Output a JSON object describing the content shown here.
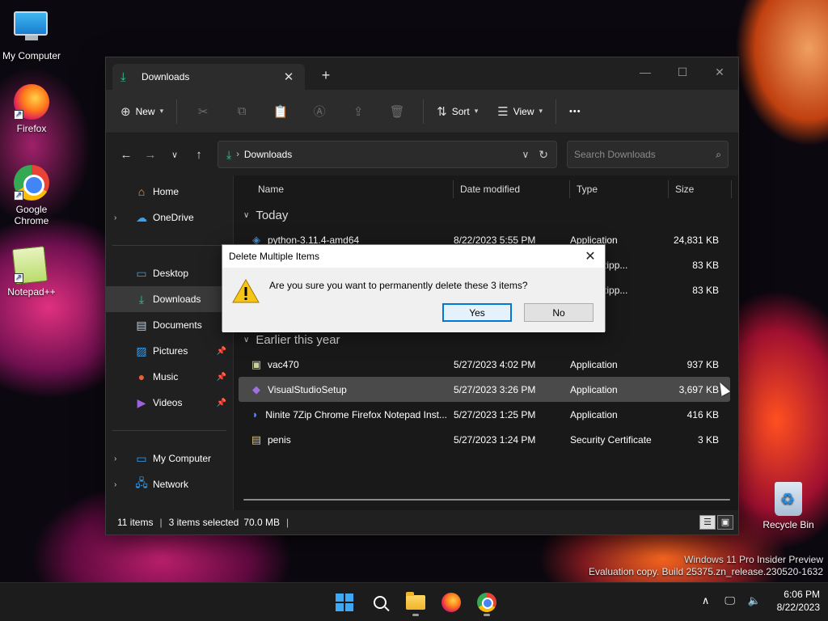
{
  "desktop": {
    "icons": [
      {
        "label": "My Computer"
      },
      {
        "label": "Firefox"
      },
      {
        "label": "Google Chrome"
      },
      {
        "label": "Notepad++"
      }
    ],
    "recycle_bin": "Recycle Bin",
    "watermark_line1": "Windows 11 Pro Insider Preview",
    "watermark_line2": "Evaluation copy. Build 25375.zn_release.230520-1632"
  },
  "window": {
    "tab_title": "Downloads",
    "new_tab_symbol": "+",
    "toolbar": {
      "new_label": "New",
      "sort_label": "Sort",
      "view_label": "View",
      "more_symbol": "•••"
    },
    "address": {
      "crumb": "Downloads",
      "search_placeholder": "Search Downloads"
    },
    "sidebar": {
      "items": [
        {
          "label": "Home",
          "icon": "home-icon",
          "expandable": false,
          "pinned": false
        },
        {
          "label": "OneDrive",
          "icon": "cloud-icon",
          "expandable": true,
          "pinned": false
        },
        {
          "label": "Desktop",
          "icon": "desktop-icon",
          "expandable": false,
          "pinned": false
        },
        {
          "label": "Downloads",
          "icon": "download-icon",
          "expandable": false,
          "pinned": false,
          "active": true
        },
        {
          "label": "Documents",
          "icon": "document-icon",
          "expandable": false,
          "pinned": false
        },
        {
          "label": "Pictures",
          "icon": "pictures-icon",
          "expandable": false,
          "pinned": true
        },
        {
          "label": "Music",
          "icon": "music-icon",
          "expandable": false,
          "pinned": true
        },
        {
          "label": "Videos",
          "icon": "videos-icon",
          "expandable": false,
          "pinned": true
        },
        {
          "label": "My Computer",
          "icon": "computer-icon",
          "expandable": true,
          "pinned": false
        },
        {
          "label": "Network",
          "icon": "network-icon",
          "expandable": true,
          "pinned": false
        }
      ]
    },
    "columns": {
      "name": "Name",
      "date": "Date modified",
      "type": "Type",
      "size": "Size"
    },
    "groups": [
      {
        "label": "Today",
        "rows": [
          {
            "name": "python-3.11.4-amd64",
            "date": "8/22/2023 5:55 PM",
            "type": "Application",
            "size": "24,831 KB",
            "icon": "python-installer-icon"
          },
          {
            "name": "",
            "date": "",
            "type": "essed (zipp...",
            "size": "83 KB",
            "icon": "zip-icon"
          },
          {
            "name": "",
            "date": "",
            "type": "essed (zipp...",
            "size": "83 KB",
            "icon": "zip-icon"
          },
          {
            "name": "",
            "date": "",
            "type": "der",
            "size": "",
            "icon": "folder-icon"
          }
        ]
      },
      {
        "label": "Earlier this year",
        "rows": [
          {
            "name": "vac470",
            "date": "5/27/2023 4:02 PM",
            "type": "Application",
            "size": "937 KB",
            "icon": "app-icon"
          },
          {
            "name": "VisualStudioSetup",
            "date": "5/27/2023 3:26 PM",
            "type": "Application",
            "size": "3,697 KB",
            "icon": "visual-studio-icon",
            "selected": true
          },
          {
            "name": "Ninite 7Zip Chrome Firefox Notepad Inst...",
            "date": "5/27/2023 1:25 PM",
            "type": "Application",
            "size": "416 KB",
            "icon": "ninite-icon"
          },
          {
            "name": "penis",
            "date": "5/27/2023 1:24 PM",
            "type": "Security Certificate",
            "size": "3 KB",
            "icon": "certificate-icon"
          }
        ]
      }
    ],
    "status": {
      "items": "11 items",
      "selected": "3 items selected",
      "size": "70.0 MB"
    }
  },
  "dialog": {
    "title": "Delete Multiple Items",
    "message": "Are you sure you want to permanently delete these 3 items?",
    "yes_label": "Yes",
    "no_label": "No"
  },
  "taskbar": {
    "time": "6:06 PM",
    "date": "8/22/2023"
  }
}
